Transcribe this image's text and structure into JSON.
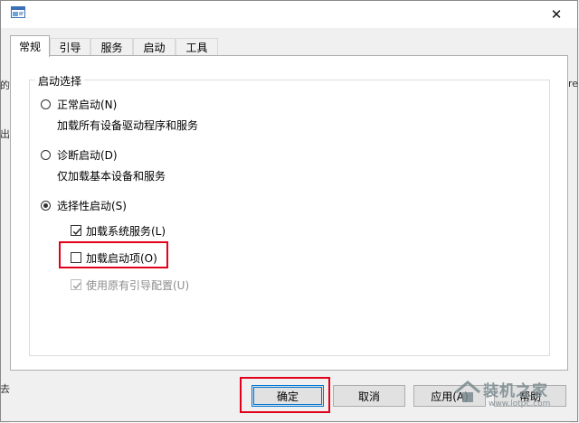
{
  "window": {
    "close_glyph": "✕"
  },
  "background": {
    "left_glyphs": [
      "的",
      "出",
      "去"
    ],
    "right_glyphs": [
      "re"
    ]
  },
  "tabs": [
    {
      "label": "常规",
      "active": true
    },
    {
      "label": "引导",
      "active": false
    },
    {
      "label": "服务",
      "active": false
    },
    {
      "label": "启动",
      "active": false
    },
    {
      "label": "工具",
      "active": false
    }
  ],
  "startup_selection": {
    "group_label": "启动选择",
    "normal": {
      "label": "正常启动(N)",
      "description": "加载所有设备驱动程序和服务",
      "checked": false
    },
    "diagnostic": {
      "label": "诊断启动(D)",
      "description": "仅加载基本设备和服务",
      "checked": false
    },
    "selective": {
      "label": "选择性启动(S)",
      "checked": true,
      "options": [
        {
          "label": "加载系统服务(L)",
          "checked": true,
          "enabled": true
        },
        {
          "label": "加载启动项(O)",
          "checked": false,
          "enabled": true
        },
        {
          "label": "使用原有引导配置(U)",
          "checked": true,
          "enabled": false
        }
      ]
    }
  },
  "buttons": {
    "ok": "确定",
    "cancel": "取消",
    "apply": "应用(A)",
    "help": "帮助"
  },
  "watermark": {
    "brand": "装机之家",
    "url": "www.lotpc.com"
  },
  "colors": {
    "highlight": "#e2001a",
    "focus": "#0078d7"
  }
}
